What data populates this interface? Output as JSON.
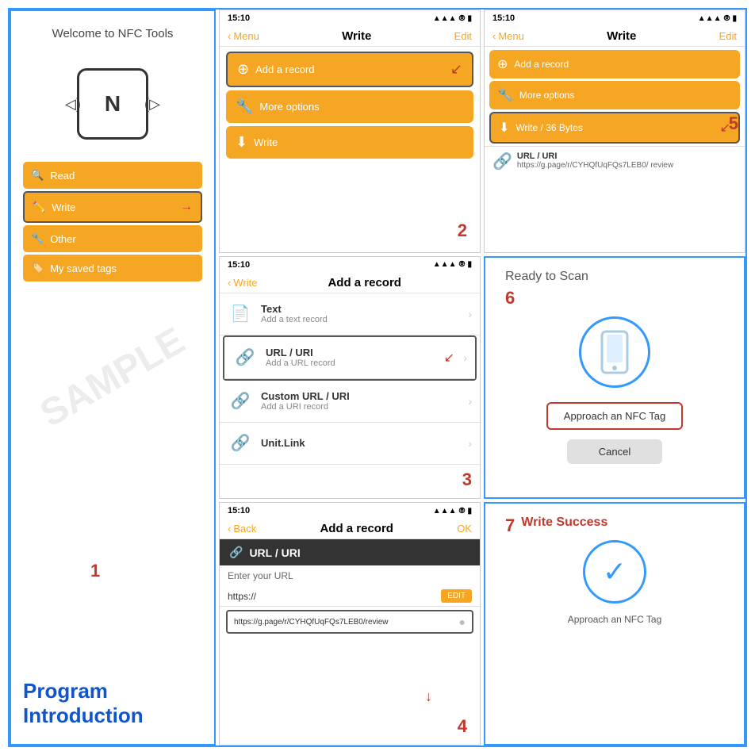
{
  "panels": {
    "p1": {
      "welcome": "Welcome to NFC Tools",
      "step": "1",
      "menu": {
        "read": "Read",
        "write": "Write",
        "other": "Other",
        "saved": "My saved tags"
      }
    },
    "p2": {
      "status_time": "15:10",
      "nav_back": "Menu",
      "nav_title": "Write",
      "nav_edit": "Edit",
      "add_record": "Add a record",
      "more_options": "More options",
      "write": "Write",
      "step": "2"
    },
    "p3": {
      "status_time": "15:10",
      "nav_back": "Write",
      "nav_title": "Add a record",
      "items": [
        {
          "title": "Text",
          "sub": "Add a text record"
        },
        {
          "title": "URL / URI",
          "sub": "Add a URL record"
        },
        {
          "title": "Custom URL / URI",
          "sub": "Add a URI record"
        },
        {
          "title": "Unit.Link",
          "sub": ""
        }
      ],
      "step": "3"
    },
    "p4": {
      "status_time": "15:10",
      "nav_back": "Back",
      "nav_title": "Add a record",
      "nav_ok": "OK",
      "header": "URL / URI",
      "enter_url": "Enter your URL",
      "url_prefix": "https://",
      "edit_btn": "EDIT",
      "url_value": "https://g.page/r/CYHQfUqFQs7LEB0/review",
      "step": "4"
    },
    "p5": {
      "status_time": "15:10",
      "nav_back": "Menu",
      "nav_title": "Write",
      "nav_edit": "Edit",
      "add_record": "Add a record",
      "more_options": "More options",
      "write_bytes": "Write / 36 Bytes",
      "url_label": "URL / URI",
      "url_value": "https://g.page/r/CYHQfUqFQs7LEB0/\nreview",
      "step": "5"
    },
    "p6": {
      "ready": "Ready to Scan",
      "approach": "Approach an NFC Tag",
      "cancel": "Cancel",
      "step": "6"
    },
    "p7": {
      "success": "Write Success",
      "approach": "Approach an NFC Tag",
      "step": "7"
    }
  },
  "program_intro": {
    "line1": "Program",
    "line2": "Introduction"
  }
}
